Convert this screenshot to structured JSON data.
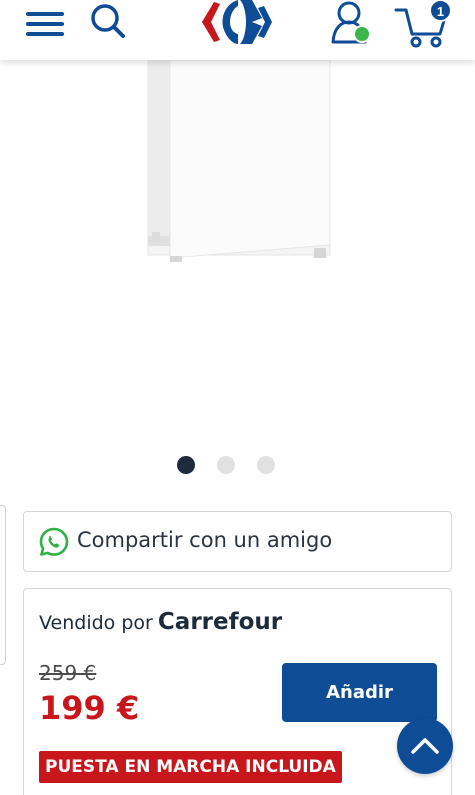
{
  "header": {
    "menu_icon": "hamburger-menu-icon",
    "search_icon": "search-icon",
    "logo": "carrefour-logo",
    "account_icon": "user-account-icon",
    "cart_icon": "shopping-cart-icon",
    "cart_count": "1",
    "brand_color": "#0f4c96",
    "accent_red": "#c8161d",
    "status_green": "#3ab54a"
  },
  "gallery": {
    "image": "white-fridge-product-image",
    "total": 3,
    "active_index": 1
  },
  "share": {
    "icon": "whatsapp-icon",
    "label": "Compartir con un amigo"
  },
  "seller": {
    "label": "Vendido por",
    "name": "Carrefour",
    "old_price": "259 €",
    "price": "199 €",
    "add_label": "Añadir",
    "badge": "PUESTA EN MARCHA INCLUIDA"
  },
  "scroll_top_icon": "chevron-up-icon"
}
